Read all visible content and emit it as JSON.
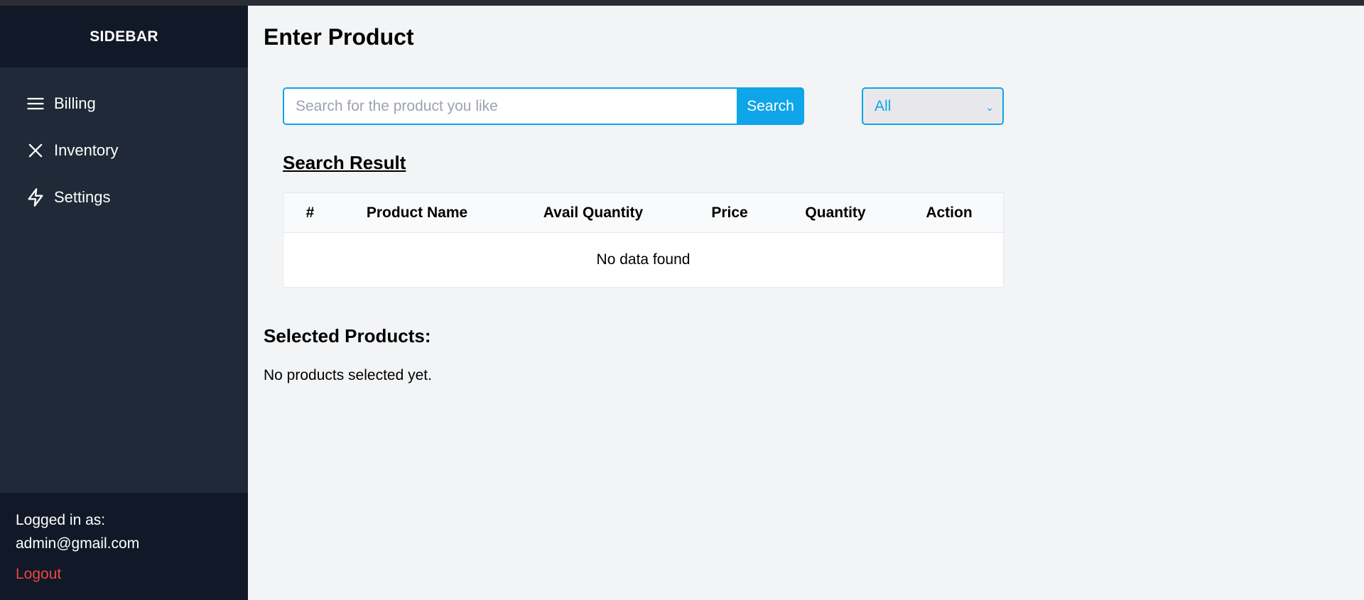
{
  "sidebar": {
    "title": "SIDEBAR",
    "items": [
      {
        "label": "Billing",
        "icon": "menu-icon"
      },
      {
        "label": "Inventory",
        "icon": "close-icon"
      },
      {
        "label": "Settings",
        "icon": "lightning-icon"
      }
    ],
    "footer": {
      "logged_in_label": "Logged in as:",
      "email": "admin@gmail.com",
      "logout_label": "Logout"
    }
  },
  "main": {
    "title": "Enter Product",
    "search": {
      "placeholder": "Search for the product you like",
      "value": "",
      "button_label": "Search"
    },
    "filter": {
      "selected": "All"
    },
    "results": {
      "title": "Search Result",
      "columns": [
        "#",
        "Product Name",
        "Avail Quantity",
        "Price",
        "Quantity",
        "Action"
      ],
      "empty_text": "No data found"
    },
    "selected_products": {
      "title": "Selected Products:",
      "empty_text": "No products selected yet."
    }
  },
  "colors": {
    "sidebar_bg": "#1f2937",
    "sidebar_header_bg": "#111827",
    "accent": "#0ea5e9",
    "logout": "#ef4444",
    "page_bg": "#f3f4f6"
  }
}
